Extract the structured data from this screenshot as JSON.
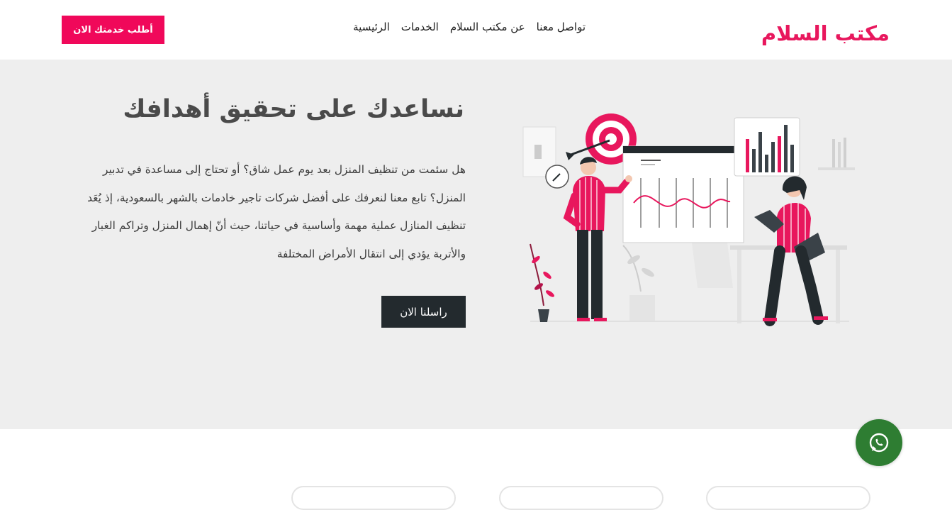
{
  "header": {
    "brand": "مكتب السلام",
    "nav": [
      "تواصل معنا",
      "عن مكتب السلام",
      "الخدمات",
      "الرئيسية"
    ],
    "cta_label": "أطلب خدمتك الان"
  },
  "hero": {
    "title": "نساعدك على تحقيق أهدافك",
    "text": "هل سئمت من تنظيف المنزل بعد يوم عمل شاق؟ أو تحتاج إلى مساعدة في تدبير المنزل؟ تابع معنا لنعرفك على أفضل شركات تاجير خادمات بالشهر بالسعودية، إذ يُعَد تنظيف المنازل عملية مهمة وأساسية في حياتنا، حيث أنّ إهمال المنزل وتراكم الغبار والأتربة يؤدي إلى انتقال الأمراض المختلفة",
    "button_label": "راسلنا الان"
  },
  "colors": {
    "brand": "#e8175d",
    "cta": "#f0085a",
    "hero_bg": "#eeeeee",
    "dark_button": "#232a2e",
    "whatsapp": "#2e7d32"
  },
  "icons": {
    "whatsapp": "whatsapp-icon",
    "illustration": "business-goals-illustration"
  }
}
